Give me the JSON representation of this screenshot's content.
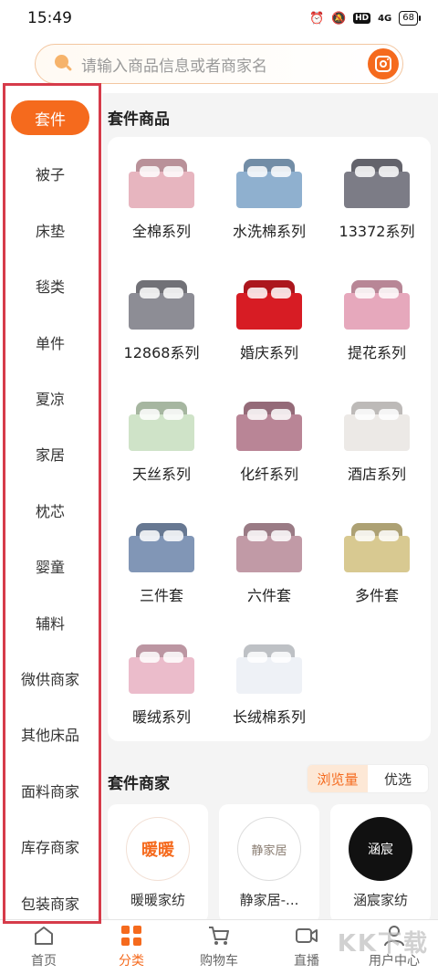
{
  "status_bar": {
    "time": "15:49",
    "hd": "HD",
    "network": "4G",
    "battery": "68"
  },
  "search": {
    "placeholder": "请输入商品信息或者商家名"
  },
  "sidebar": {
    "items": [
      {
        "label": "套件",
        "active": true
      },
      {
        "label": "被子"
      },
      {
        "label": "床垫"
      },
      {
        "label": "毯类"
      },
      {
        "label": "单件"
      },
      {
        "label": "夏凉"
      },
      {
        "label": "家居"
      },
      {
        "label": "枕芯"
      },
      {
        "label": "婴童"
      },
      {
        "label": "辅料"
      },
      {
        "label": "微供商家"
      },
      {
        "label": "其他床品"
      },
      {
        "label": "面料商家"
      },
      {
        "label": "库存商家"
      },
      {
        "label": "包装商家"
      }
    ]
  },
  "products_section": {
    "title": "套件商品",
    "items": [
      {
        "label": "全棉系列",
        "color": "#e7b5bf"
      },
      {
        "label": "水洗棉系列",
        "color": "#8fb0cf"
      },
      {
        "label": "13372系列",
        "color": "#7c7c86"
      },
      {
        "label": "12868系列",
        "color": "#8d8d95"
      },
      {
        "label": "婚庆系列",
        "color": "#d71c24"
      },
      {
        "label": "提花系列",
        "color": "#e6a8bc"
      },
      {
        "label": "天丝系列",
        "color": "#cfe3c8"
      },
      {
        "label": "化纤系列",
        "color": "#b98596"
      },
      {
        "label": "酒店系列",
        "color": "#ece9e6"
      },
      {
        "label": "三件套",
        "color": "#8196b6"
      },
      {
        "label": "六件套",
        "color": "#c19aa6"
      },
      {
        "label": "多件套",
        "color": "#d8c991"
      },
      {
        "label": "暖绒系列",
        "color": "#ebbccb"
      },
      {
        "label": "长绒棉系列",
        "color": "#eef1f6"
      }
    ]
  },
  "merchants_section": {
    "title": "套件商家",
    "sort_tabs": [
      {
        "label": "浏览量",
        "active": true
      },
      {
        "label": "优选"
      }
    ],
    "items": [
      {
        "name": "暖暖家纺",
        "logo_text": "暖暖"
      },
      {
        "name": "静家居-...",
        "logo_text": "静家居"
      },
      {
        "name": "涵宸家纺",
        "logo_text": "涵宸"
      }
    ]
  },
  "bottom_nav": {
    "items": [
      {
        "label": "首页",
        "icon": "home-icon"
      },
      {
        "label": "分类",
        "icon": "category-icon",
        "active": true
      },
      {
        "label": "购物车",
        "icon": "cart-icon"
      },
      {
        "label": "直播",
        "icon": "live-icon"
      },
      {
        "label": "用户中心",
        "icon": "user-icon"
      }
    ]
  },
  "watermark": "KK下载"
}
